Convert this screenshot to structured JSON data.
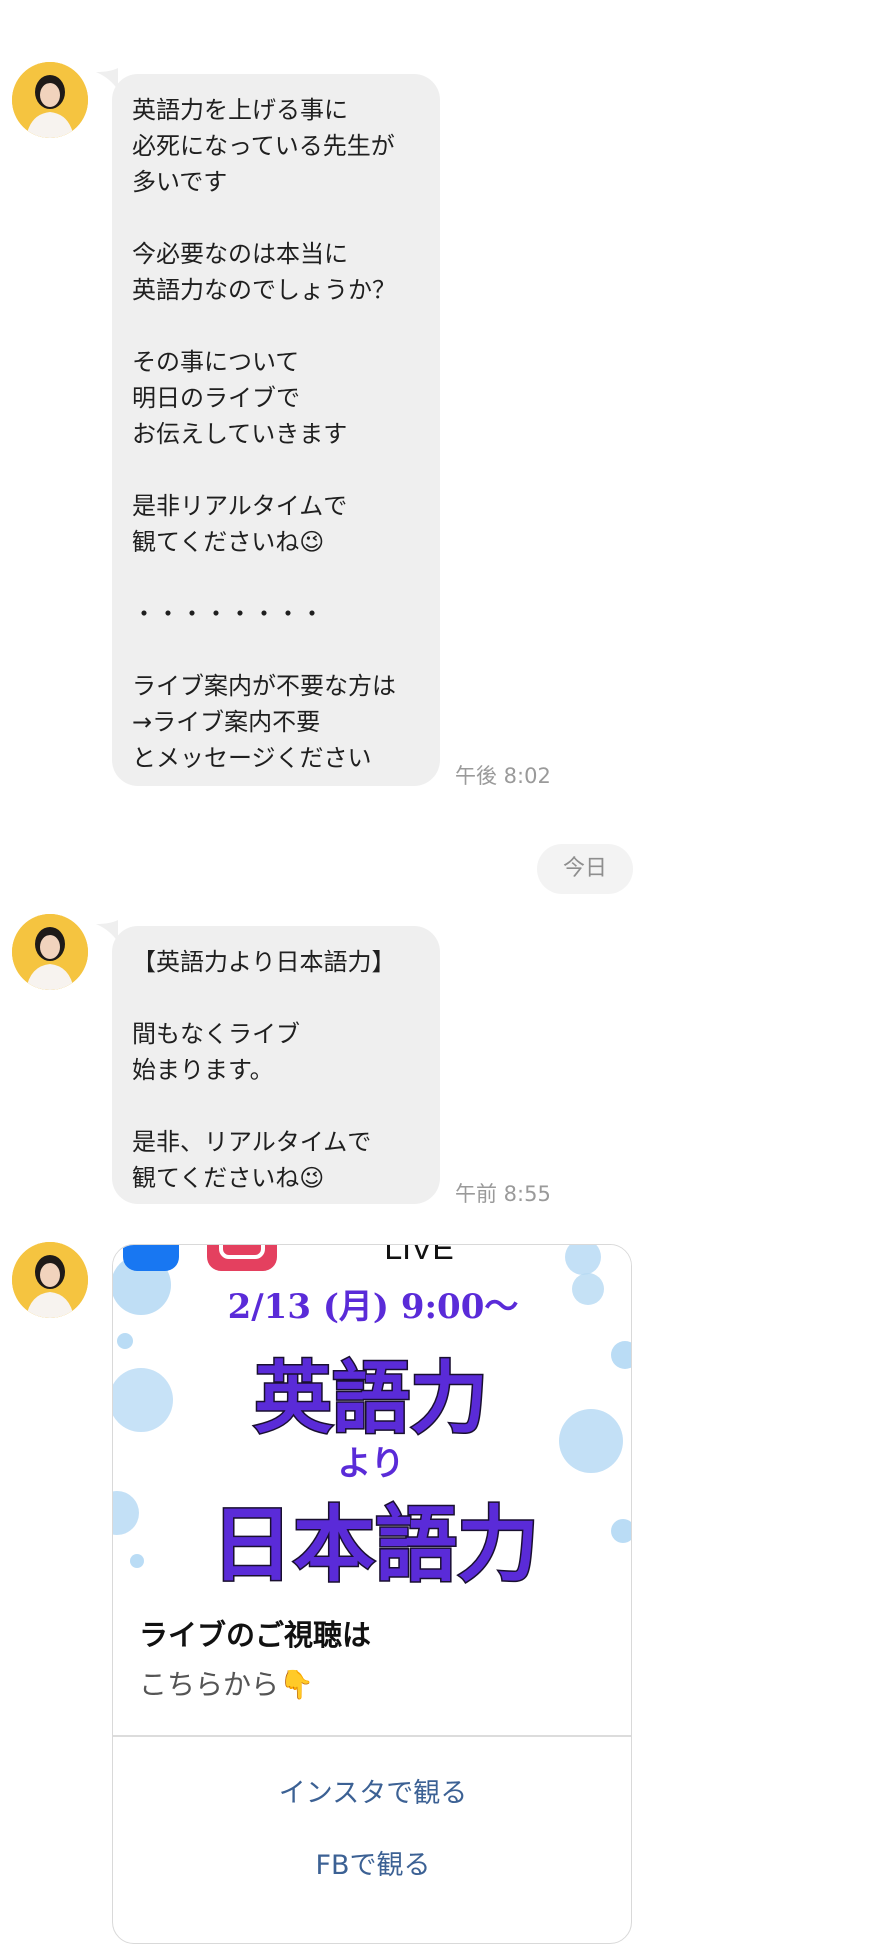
{
  "messages": [
    {
      "text": "英語力を上げる事に\n必死になっている先生が\n多いです\n\n今必要なのは本当に\n英語力なのでしょうか？\n\nその事について\n明日のライブで\nお伝えしていきます\n\n是非リアルタイムで\n観てくださいね😉\n\n・・・・・・・・\n\nライブ案内が不要な方は\n→ライブ案内不要\nとメッセージください",
      "time": "午後 8:02"
    },
    {
      "text": "【英語力より日本語力】\n\n間もなくライブ\n始まります。\n\n是非、リアルタイムで\n観てくださいね😉",
      "time": "午前 8:55"
    }
  ],
  "date_separator": "今日",
  "card": {
    "image": {
      "top_text": "LIVE",
      "date_text": "2/13 (月) 9:00〜",
      "headline_1": "英語力",
      "connector": "より",
      "headline_2": "日本語力",
      "colors": {
        "purple": "#5a2bd8",
        "bubble_blue": "#9fcdf0"
      }
    },
    "title": "ライブのご視聴は",
    "subtitle": "こちらから👇",
    "actions": [
      "インスタで観る",
      "FBで観る"
    ]
  },
  "colors": {
    "bubble_bg": "#efefef",
    "link": "#3c6194",
    "avatar_bg": "#f5c440"
  }
}
